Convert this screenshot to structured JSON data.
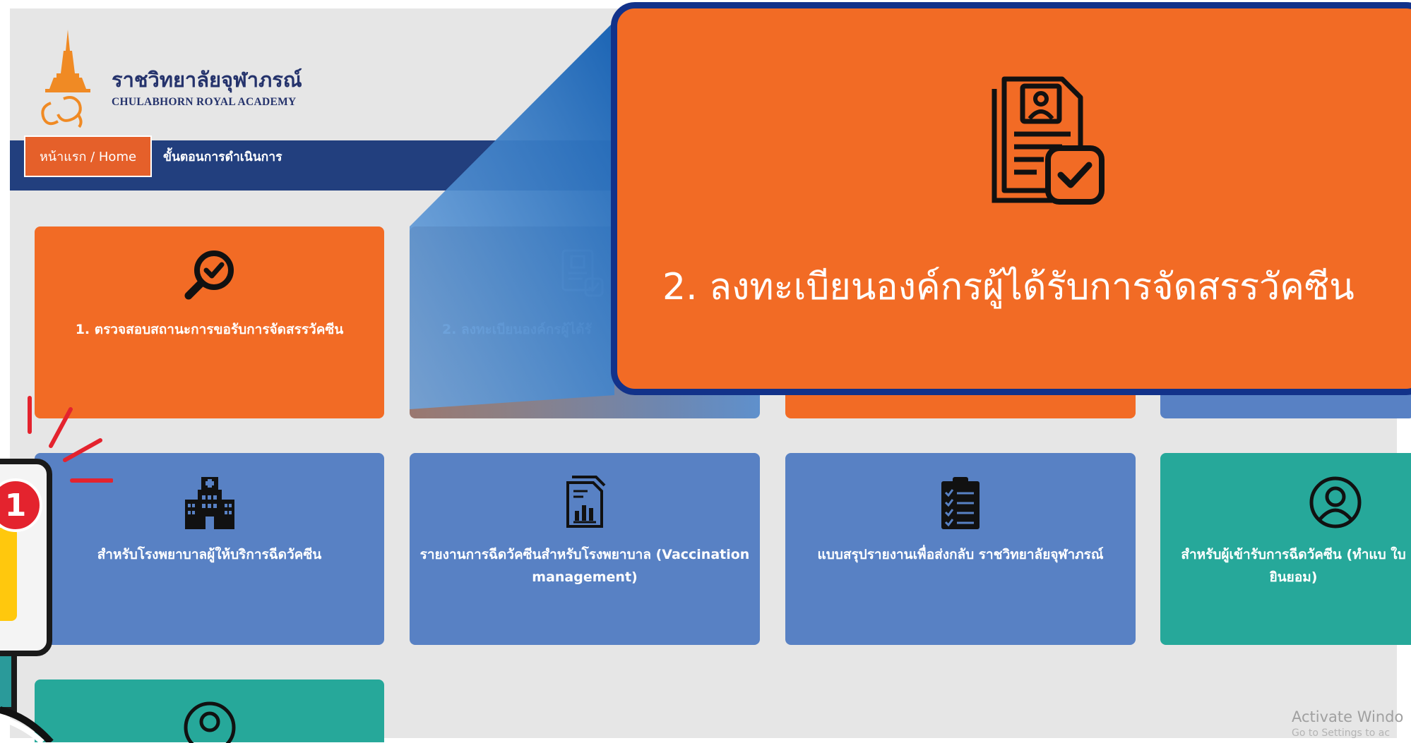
{
  "logo": {
    "name_th": "ราชวิทยาลัยจุฬาภรณ์",
    "name_en": "CHULABHORN ROYAL ACADEMY"
  },
  "breadcrumb": {
    "home_label": "หน้าแรก / Home",
    "current": "ขั้นตอนการดำเนินการ"
  },
  "cards": [
    {
      "label": "1. ตรวจสอบสถานะการขอรับการจัดสรรวัคซีน",
      "icon": "search-check-icon",
      "color": "#f26b25"
    },
    {
      "label": "2. ลงทะเบียนองค์กรผู้ได้รั",
      "icon": "document-check-icon",
      "color": "#f26b25"
    },
    {
      "label": "สำหรับโรงพยาบาลผู้ให้บริการฉีดวัคซีน",
      "icon": "hospital-icon",
      "color": "#5881c4"
    },
    {
      "label": "รายงานการฉีดวัคซีนสำหรับโรงพยาบาล (Vaccination management)",
      "icon": "report-icon",
      "color": "#5881c4"
    },
    {
      "label": "แบบสรุปรายงานเพื่อส่งกลับ ราชวิทยาลัยจุฬาภรณ์",
      "icon": "clipboard-icon",
      "color": "#5881c4"
    },
    {
      "label": "สำหรับผู้เข้ารับการฉีดวัคซีน (ทำแบ ใบยินยอม)",
      "icon": "user-icon",
      "color": "#26a89a"
    }
  ],
  "zoom": {
    "label": "2. ลงทะเบียนองค์กรผู้ได้รับการจัดสรรวัคซีน",
    "icon": "document-check-icon"
  },
  "step_badge": "1",
  "watermark": {
    "title": "Activate Windo",
    "subtitle": "Go to Settings to ac"
  },
  "colors": {
    "orange": "#f26b25",
    "blue": "#5881c4",
    "teal": "#26a89a",
    "navy": "#223f7e"
  }
}
